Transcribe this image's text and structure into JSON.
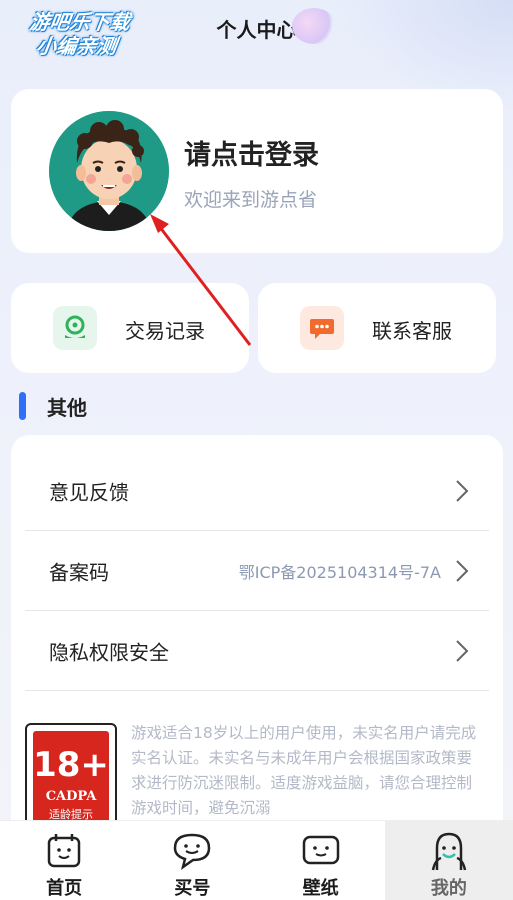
{
  "watermark": {
    "line1": "游吧乐下载",
    "line2": "小编亲测"
  },
  "header": {
    "title": "个人中心"
  },
  "profile": {
    "login_title": "请点击登录",
    "welcome": "欢迎来到游点省"
  },
  "quick_actions": [
    {
      "label": "交易记录",
      "icon": "transaction-record-icon",
      "color": "#2fb35a"
    },
    {
      "label": "联系客服",
      "icon": "customer-service-icon",
      "color": "#f26a2e"
    }
  ],
  "section": {
    "title": "其他",
    "accent": "#2f6ef6"
  },
  "list": [
    {
      "label": "意见反馈",
      "value": ""
    },
    {
      "label": "备案码",
      "value": "鄂ICP备2025104314号-7A"
    },
    {
      "label": "隐私权限安全",
      "value": ""
    }
  ],
  "rating": {
    "age": "18+",
    "code": "CADPA",
    "desc": "适龄提示"
  },
  "notice": "游戏适合18岁以上的用户使用，未实名用户请完成实名认证。未实名与未成年用户会根据国家政策要求进行防沉迷限制。适度游戏益脑，请您合理控制游戏时间，避免沉溺",
  "tabs": [
    {
      "label": "首页",
      "icon": "home-icon",
      "active": false
    },
    {
      "label": "买号",
      "icon": "buy-account-icon",
      "active": false
    },
    {
      "label": "壁纸",
      "icon": "wallpaper-icon",
      "active": false
    },
    {
      "label": "我的",
      "icon": "profile-icon",
      "active": true
    }
  ]
}
